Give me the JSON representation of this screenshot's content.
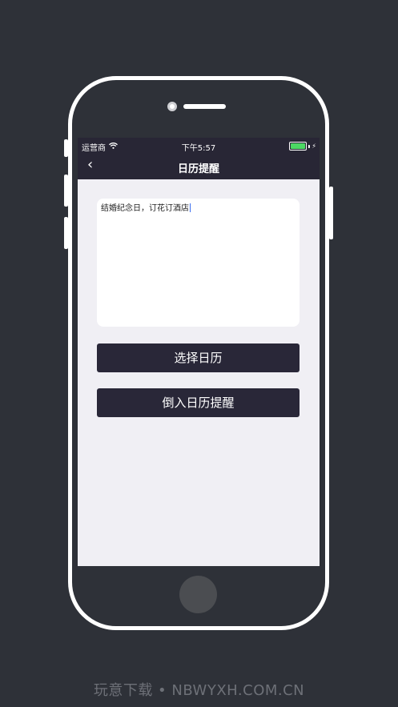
{
  "status_bar": {
    "carrier": "运营商",
    "time": "下午5:57",
    "battery_color": "#4cd964"
  },
  "nav": {
    "back_icon": "chevron-left-icon",
    "back_glyph": "‹",
    "title": "日历提醒"
  },
  "note": {
    "text": "结婚纪念日，订花订酒店"
  },
  "buttons": {
    "select_calendar": "选择日历",
    "import_reminder": "倒入日历提醒"
  },
  "watermark": "玩意下载 • NBWYXH.COM.CN",
  "colors": {
    "background": "#2e3138",
    "navbar": "#282635",
    "button": "#292738",
    "screen_bg": "#f0eff4"
  }
}
